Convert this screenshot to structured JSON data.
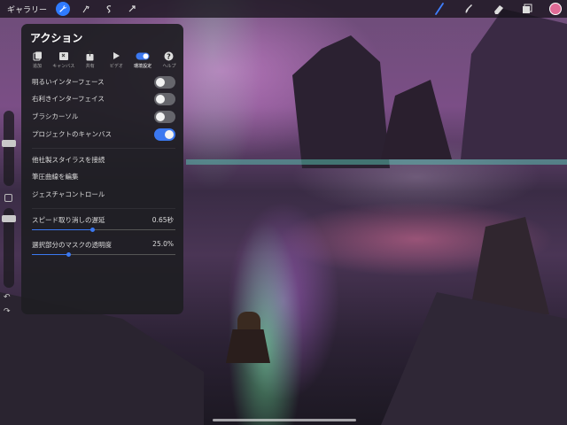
{
  "topbar": {
    "gallery_label": "ギャラリー",
    "left_tools": [
      "wrench-icon",
      "adjustments-icon",
      "selection-icon",
      "transform-icon"
    ],
    "right_tools": [
      "brush-icon",
      "smudge-icon",
      "eraser-icon",
      "layers-icon"
    ],
    "color": "#e06a96",
    "accent": "#2f7bff"
  },
  "panel": {
    "title": "アクション",
    "tabs": [
      {
        "label": "追加",
        "icon": "add-icon"
      },
      {
        "label": "キャンバス",
        "icon": "canvas-icon"
      },
      {
        "label": "共有",
        "icon": "share-icon"
      },
      {
        "label": "ビデオ",
        "icon": "video-icon"
      },
      {
        "label": "環境設定",
        "icon": "prefs-icon",
        "active": true
      },
      {
        "label": "ヘルプ",
        "icon": "help-icon"
      }
    ],
    "toggles": [
      {
        "label": "明るいインターフェース",
        "on": false
      },
      {
        "label": "右利きインターフェイス",
        "on": false
      },
      {
        "label": "ブラシカーソル",
        "on": false
      },
      {
        "label": "プロジェクトのキャンバス",
        "on": true
      }
    ],
    "links": [
      {
        "label": "他社製スタイラスを接続"
      },
      {
        "label": "筆圧曲線を編集"
      },
      {
        "label": "ジェスチャコントロール"
      }
    ],
    "sliders": [
      {
        "label": "スピード取り消しの遅延",
        "value_text": "0.65秒",
        "fraction": 0.42
      },
      {
        "label": "選択部分のマスクの透明度",
        "value_text": "25.0%",
        "fraction": 0.25
      }
    ]
  }
}
